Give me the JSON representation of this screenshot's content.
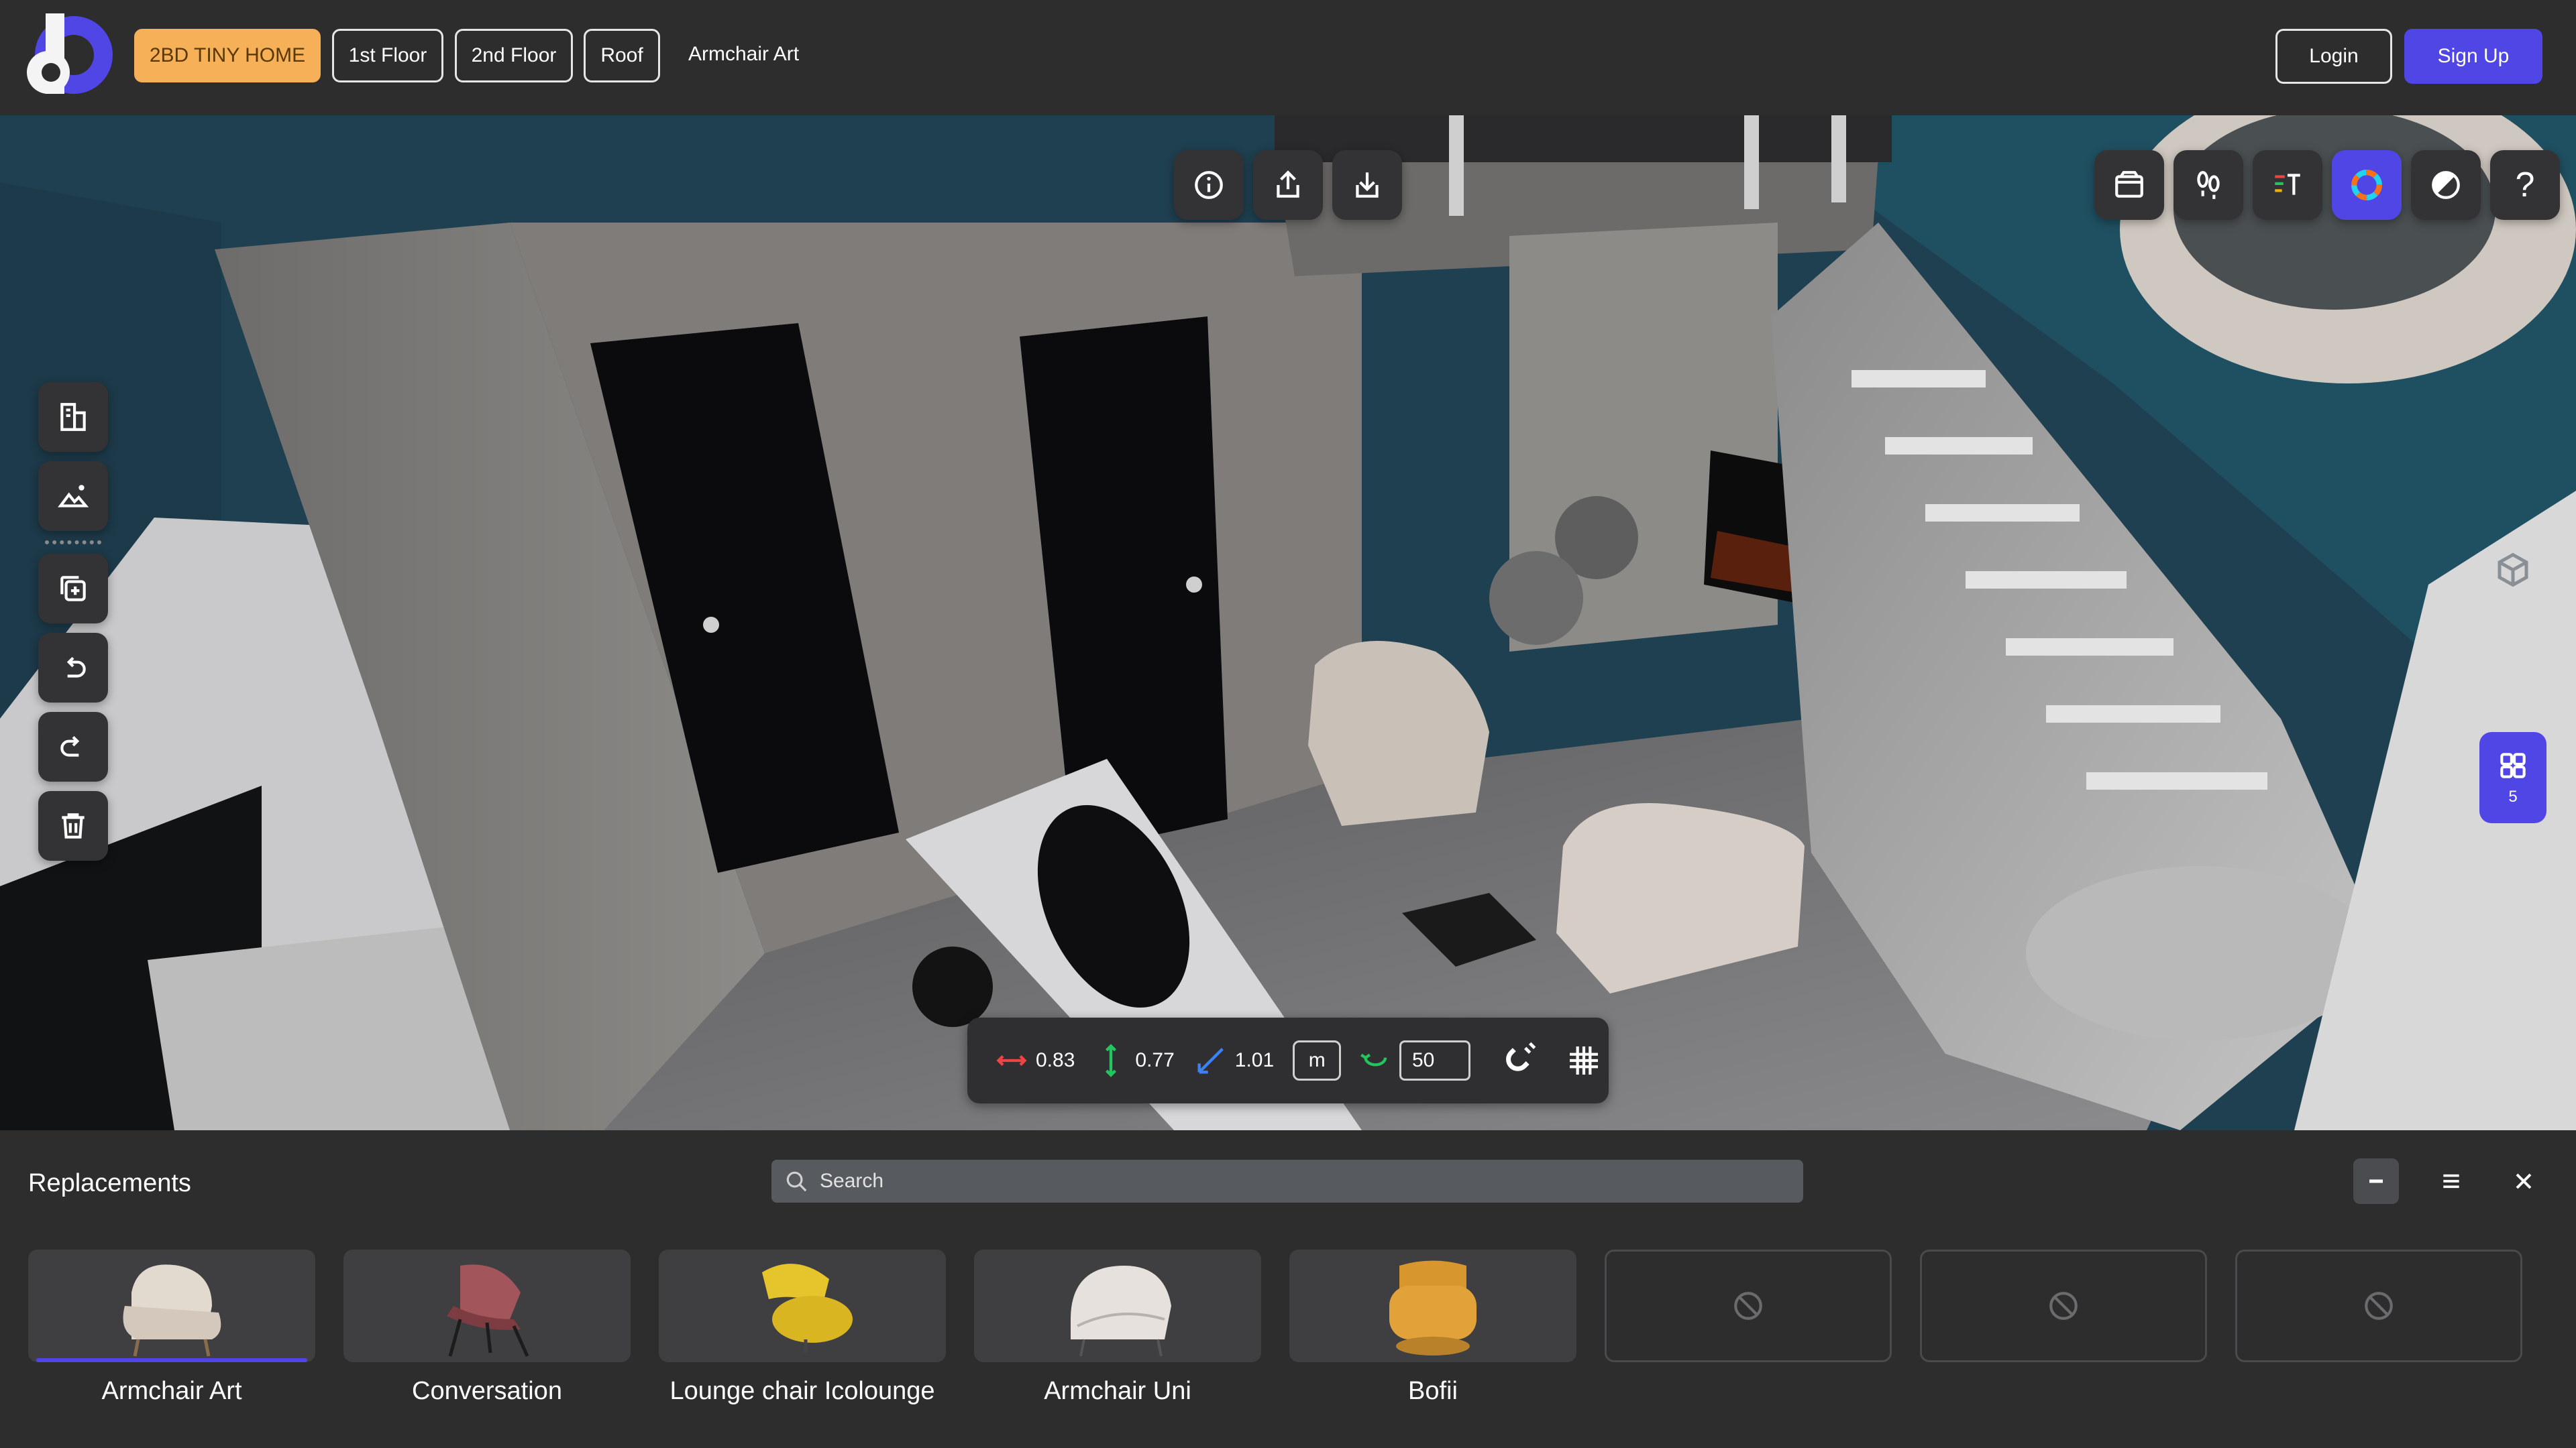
{
  "header": {
    "logo_letter": "d",
    "floors": [
      "2BD TINY HOME",
      "1st Floor",
      "2nd Floor",
      "Roof"
    ],
    "active_floor_index": 0,
    "breadcrumb": "Armchair Art",
    "login_label": "Login",
    "signup_label": "Sign Up"
  },
  "viewport": {
    "top_toolbar": [
      "info-icon",
      "share-icon",
      "download-icon"
    ],
    "right_toolbar": [
      "room-icon",
      "walk-icon",
      "materials-icon",
      "color-wheel-icon",
      "shading-icon",
      "help-icon"
    ],
    "left_toolbar": [
      "floorplan-icon",
      "landscape-icon",
      "add-object-icon",
      "undo-icon",
      "redo-icon",
      "delete-icon"
    ],
    "help_label": "?",
    "objects_tab_count": "5"
  },
  "measure": {
    "width": "0.83",
    "height": "0.77",
    "depth": "1.01",
    "unit": "m",
    "rotation": "50"
  },
  "replacements": {
    "title": "Replacements",
    "search_placeholder": "Search",
    "items": [
      {
        "label": "Armchair Art",
        "selected": true
      },
      {
        "label": "Conversation",
        "selected": false
      },
      {
        "label": "Lounge chair Icolounge",
        "selected": false
      },
      {
        "label": "Armchair Uni",
        "selected": false
      },
      {
        "label": "Bofii",
        "selected": false
      }
    ],
    "empty_slots": 3
  },
  "colors": {
    "accent": "#4f46e5",
    "active_floor": "#f5b058",
    "background": "#2d2d2d"
  }
}
